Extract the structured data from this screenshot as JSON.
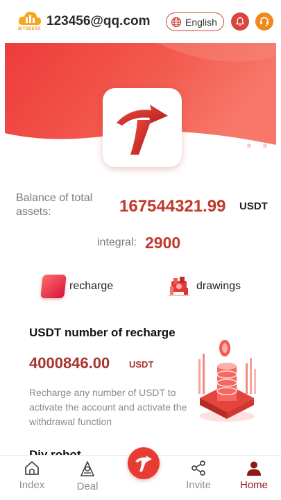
{
  "header": {
    "logo_text": "BITDEERX",
    "account": "123456@qq.com",
    "language": "English",
    "icons": [
      "globe-icon",
      "bell-icon",
      "headset-icon"
    ],
    "accent_color": "#d9453d"
  },
  "balance": {
    "label": "Balance of total assets:",
    "value": "167544321.99",
    "unit": "USDT"
  },
  "integral": {
    "label": "integral:",
    "value": "2900"
  },
  "actions": {
    "recharge": "recharge",
    "drawings": "drawings"
  },
  "recharge_card": {
    "title": "USDT number of recharge",
    "amount": "4000846.00",
    "unit": "USDT",
    "description": "Recharge any number of USDT to activate the account and activate the withdrawal function"
  },
  "next_section_title": "Diy robot",
  "bottom_nav": {
    "items": [
      {
        "label": "Index",
        "icon": "house-icon"
      },
      {
        "label": "Deal",
        "icon": "deal-icon"
      },
      {
        "label": "",
        "icon": "brand-logo-icon"
      },
      {
        "label": "Invite",
        "icon": "share-icon"
      },
      {
        "label": "Home",
        "icon": "person-icon",
        "active": true
      }
    ]
  }
}
